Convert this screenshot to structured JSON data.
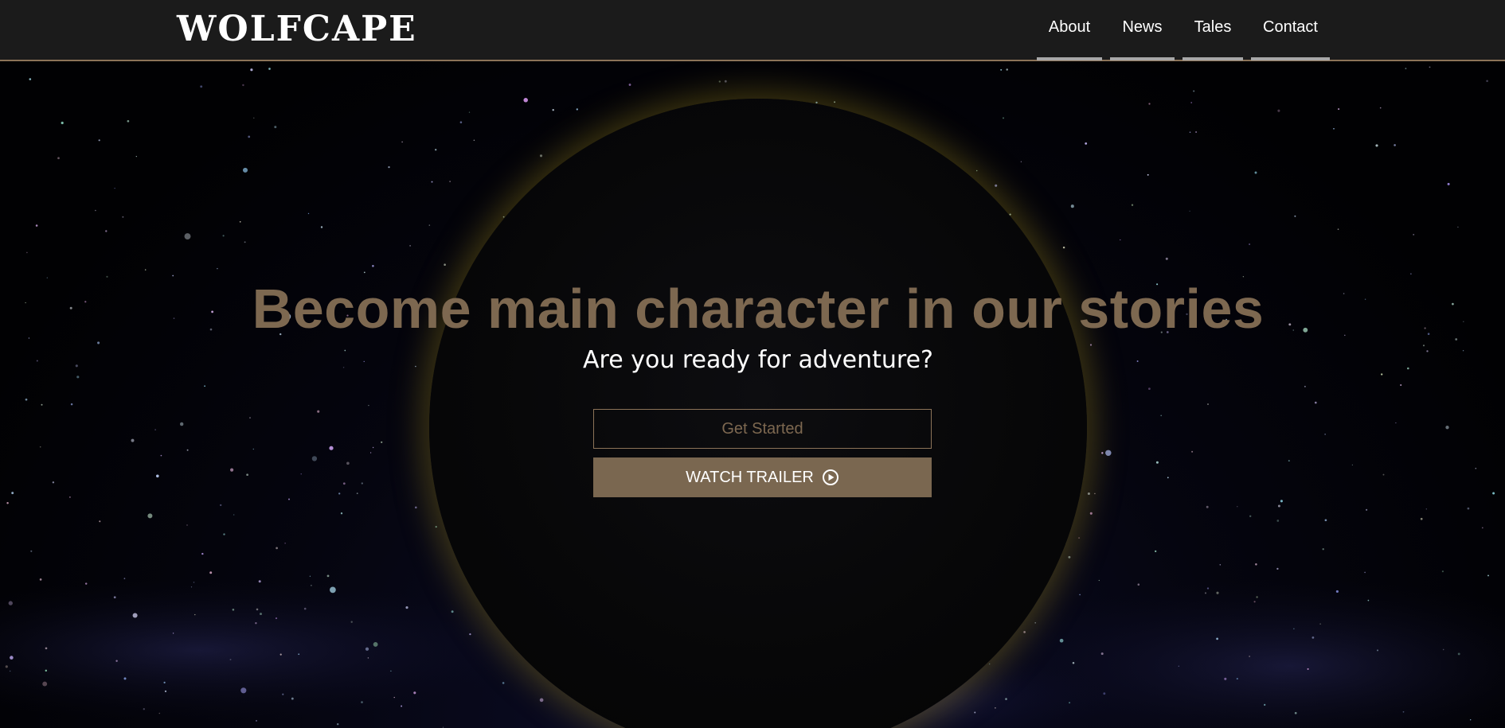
{
  "brand": {
    "logo_text": "WOLFCAPE"
  },
  "nav": {
    "items": [
      {
        "label": "About"
      },
      {
        "label": "News"
      },
      {
        "label": "Tales"
      },
      {
        "label": "Contact"
      }
    ]
  },
  "hero": {
    "headline": "Become main character in our stories",
    "subheadline": "Are you ready for adventure?",
    "get_started_label": "Get Started",
    "watch_trailer_label": "WATCH TRAILER",
    "watch_trailer_icon": "play-circle-icon"
  },
  "colors": {
    "navbar_bg": "#1b1b1b",
    "accent": "#7d6850",
    "accent_border": "#8c7358",
    "eclipse_glow": "#bea528"
  }
}
